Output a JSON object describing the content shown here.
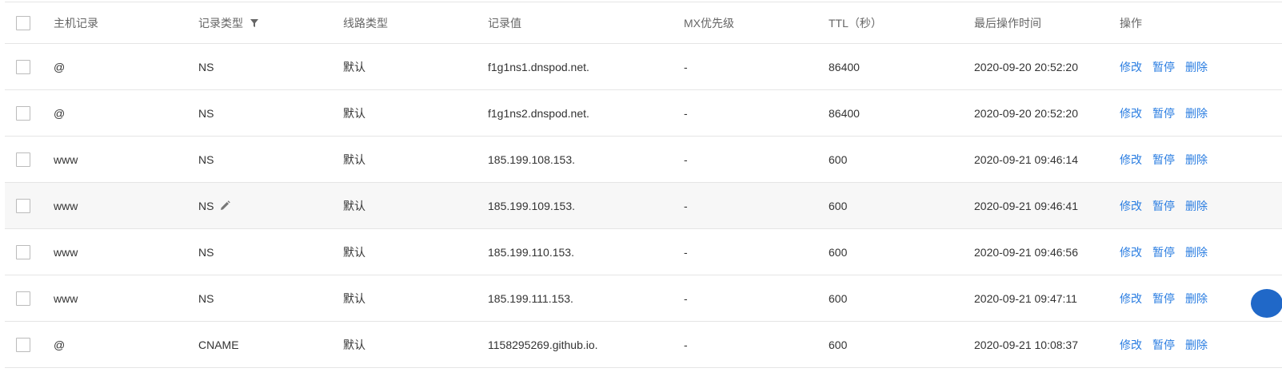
{
  "header": {
    "host": "主机记录",
    "type": "记录类型",
    "line": "线路类型",
    "value": "记录值",
    "mx": "MX优先级",
    "ttl": "TTL（秒）",
    "time": "最后操作时间",
    "ops": "操作"
  },
  "actions": {
    "edit": "修改",
    "pause": "暂停",
    "delete": "删除"
  },
  "rows": [
    {
      "host": "@",
      "type": "NS",
      "line": "默认",
      "value": "f1g1ns1.dnspod.net.",
      "mx": "-",
      "ttl": "86400",
      "time": "2020-09-20 20:52:20"
    },
    {
      "host": "@",
      "type": "NS",
      "line": "默认",
      "value": "f1g1ns2.dnspod.net.",
      "mx": "-",
      "ttl": "86400",
      "time": "2020-09-20 20:52:20"
    },
    {
      "host": "www",
      "type": "NS",
      "line": "默认",
      "value": "185.199.108.153.",
      "mx": "-",
      "ttl": "600",
      "time": "2020-09-21 09:46:14"
    },
    {
      "host": "www",
      "type": "NS",
      "line": "默认",
      "value": "185.199.109.153.",
      "mx": "-",
      "ttl": "600",
      "time": "2020-09-21 09:46:41"
    },
    {
      "host": "www",
      "type": "NS",
      "line": "默认",
      "value": "185.199.110.153.",
      "mx": "-",
      "ttl": "600",
      "time": "2020-09-21 09:46:56"
    },
    {
      "host": "www",
      "type": "NS",
      "line": "默认",
      "value": "185.199.111.153.",
      "mx": "-",
      "ttl": "600",
      "time": "2020-09-21 09:47:11"
    },
    {
      "host": "@",
      "type": "CNAME",
      "line": "默认",
      "value": "1158295269.github.io.",
      "mx": "-",
      "ttl": "600",
      "time": "2020-09-21 10:08:37"
    }
  ],
  "colors": {
    "link": "#2a7de1",
    "row_highlight": "#f7f7f7",
    "border": "#e5e5e5"
  },
  "icons": {
    "filter": "filter-icon",
    "edit": "edit-pencil-icon"
  }
}
